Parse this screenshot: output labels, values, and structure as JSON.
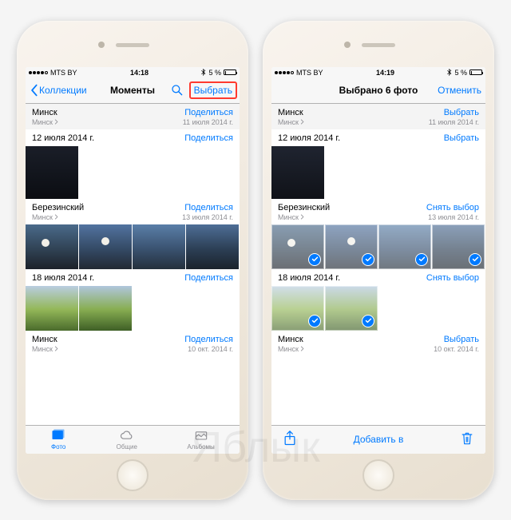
{
  "watermark": "Яблык",
  "left": {
    "status": {
      "carrier": "MTS BY",
      "time": "14:18",
      "battery_pct": "5 %"
    },
    "nav": {
      "back": "Коллекции",
      "title": "Моменты",
      "select": "Выбрать"
    },
    "sections": [
      {
        "title": "Минск",
        "sub": "Минск",
        "action": "Поделиться",
        "date": "11 июля 2014 г."
      },
      {
        "title": "12 июля 2014 г.",
        "sub": "",
        "action": "Поделиться",
        "date": ""
      },
      {
        "title": "Березинский",
        "sub": "Минск",
        "action": "Поделиться",
        "date": "13 июля 2014 г."
      },
      {
        "title": "18 июля 2014 г.",
        "sub": "",
        "action": "Поделиться",
        "date": ""
      },
      {
        "title": "Минск",
        "sub": "Минск",
        "action": "Поделиться",
        "date": "10 окт. 2014 г."
      }
    ],
    "tabs": {
      "photos": "Фото",
      "shared": "Общие",
      "albums": "Альбомы"
    }
  },
  "right": {
    "status": {
      "carrier": "MTS BY",
      "time": "14:19",
      "battery_pct": "5 %"
    },
    "nav": {
      "title": "Выбрано 6 фото",
      "cancel": "Отменить"
    },
    "sections": [
      {
        "title": "Минск",
        "sub": "Минск",
        "action": "Выбрать",
        "date": "11 июля 2014 г."
      },
      {
        "title": "12 июля 2014 г.",
        "sub": "",
        "action": "Выбрать",
        "date": ""
      },
      {
        "title": "Березинский",
        "sub": "Минск",
        "action": "Снять выбор",
        "date": "13 июля 2014 г."
      },
      {
        "title": "18 июля 2014 г.",
        "sub": "",
        "action": "Снять выбор",
        "date": ""
      },
      {
        "title": "Минск",
        "sub": "Минск",
        "action": "Выбрать",
        "date": "10 окт. 2014 г."
      }
    ],
    "actionbar": {
      "add_to": "Добавить в"
    }
  }
}
